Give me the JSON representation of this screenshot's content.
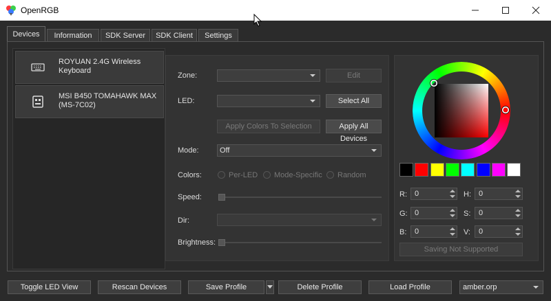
{
  "window": {
    "title": "OpenRGB"
  },
  "tabs": [
    {
      "label": "Devices"
    },
    {
      "label": "Information"
    },
    {
      "label": "SDK Server"
    },
    {
      "label": "SDK Client"
    },
    {
      "label": "Settings"
    }
  ],
  "devices": [
    {
      "name": "ROYUAN 2.4G Wireless Keyboard",
      "icon": "keyboard-icon"
    },
    {
      "name": "MSI B450 TOMAHAWK MAX (MS-7C02)",
      "icon": "motherboard-icon"
    }
  ],
  "controls": {
    "zone_label": "Zone:",
    "zone_value": "",
    "edit_button": "Edit",
    "led_label": "LED:",
    "led_value": "",
    "select_all_button": "Select All",
    "apply_selection_button": "Apply Colors To Selection",
    "apply_all_button": "Apply All Devices",
    "mode_label": "Mode:",
    "mode_value": "Off",
    "colors_label": "Colors:",
    "color_modes": [
      "Per-LED",
      "Mode-Specific",
      "Random"
    ],
    "speed_label": "Speed:",
    "dir_label": "Dir:",
    "dir_value": "",
    "brightness_label": "Brightness:"
  },
  "color_picker": {
    "swatches": [
      "#000000",
      "#ff0000",
      "#ffff00",
      "#00ff00",
      "#00ffff",
      "#0000ff",
      "#ff00ff",
      "#ffffff"
    ],
    "fields": {
      "r_label": "R:",
      "r": "0",
      "h_label": "H:",
      "h": "0",
      "g_label": "G:",
      "g": "0",
      "s_label": "S:",
      "s": "0",
      "b_label": "B:",
      "b": "0",
      "v_label": "V:",
      "v": "0"
    },
    "saving_button": "Saving Not Supported"
  },
  "bottom": {
    "toggle_led_view": "Toggle LED View",
    "rescan_devices": "Rescan Devices",
    "save_profile": "Save Profile",
    "delete_profile": "Delete Profile",
    "load_profile": "Load Profile",
    "profile_value": "amber.orp"
  }
}
